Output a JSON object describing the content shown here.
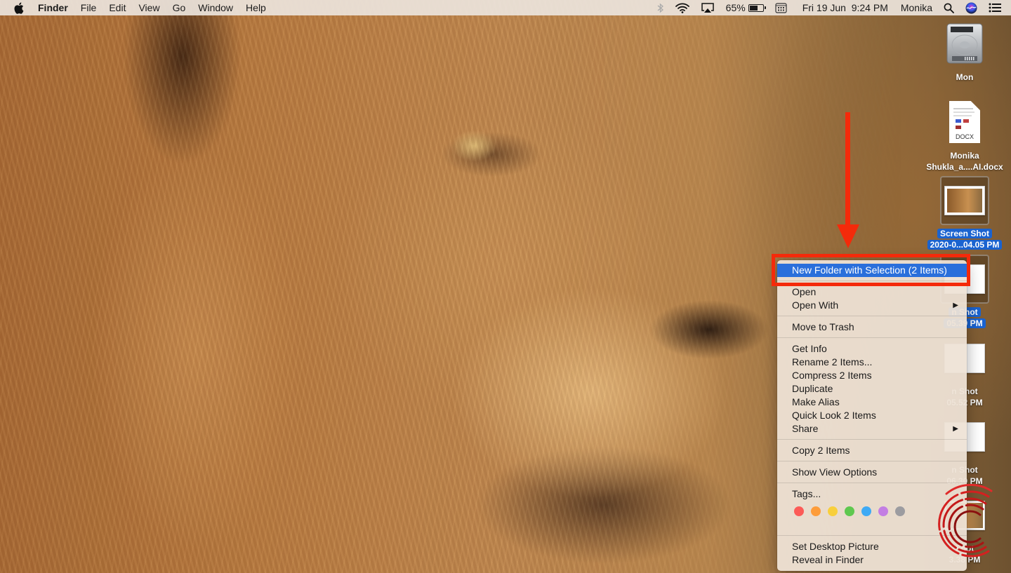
{
  "menubar": {
    "app_name": "Finder",
    "menus": [
      "File",
      "Edit",
      "View",
      "Go",
      "Window",
      "Help"
    ],
    "status": {
      "battery_percent": "65%",
      "battery_level": 0.65,
      "datetime": "Fri 19 Jun  9:24 PM",
      "user": "Monika"
    },
    "icons": [
      "apple-icon",
      "bluetooth-icon",
      "wifi-icon",
      "airplay-icon",
      "battery-icon",
      "keyboard-viewer-icon",
      "spotlight-search-icon",
      "siri-icon",
      "notification-center-icon"
    ]
  },
  "desktop": {
    "icons": [
      {
        "label_line1": "Mon",
        "label_line2": "",
        "type": "hard-drive",
        "selected": false
      },
      {
        "label_line1": "Monika",
        "label_line2": "Shukla_a....AI.docx",
        "type": "docx",
        "badge": "DOCX",
        "selected": false
      },
      {
        "label_line1": "Screen Shot",
        "label_line2": "2020-0...04.05 PM",
        "type": "screenshot",
        "selected": true
      },
      {
        "label_line1": "n Shot",
        "label_line2": "05.39 PM",
        "type": "screenshot",
        "selected": true
      },
      {
        "label_line1": "n Shot",
        "label_line2": "05.52 PM",
        "type": "screenshot",
        "selected": false
      },
      {
        "label_line1": "n Shot",
        "label_line2": "06.30 PM",
        "type": "screenshot",
        "selected": false
      },
      {
        "label_line1": "Shot",
        "label_line2": "3.38 PM",
        "type": "screenshot",
        "selected": false
      }
    ]
  },
  "context_menu": {
    "groups": [
      [
        {
          "label": "New Folder with Selection (2 Items)",
          "highlighted": true
        }
      ],
      [
        {
          "label": "Open"
        },
        {
          "label": "Open With",
          "submenu": true
        }
      ],
      [
        {
          "label": "Move to Trash"
        }
      ],
      [
        {
          "label": "Get Info"
        },
        {
          "label": "Rename 2 Items..."
        },
        {
          "label": "Compress 2 Items"
        },
        {
          "label": "Duplicate"
        },
        {
          "label": "Make Alias"
        },
        {
          "label": "Quick Look 2 Items"
        },
        {
          "label": "Share",
          "submenu": true
        }
      ],
      [
        {
          "label": "Copy 2 Items"
        }
      ],
      [
        {
          "label": "Show View Options"
        }
      ],
      [
        {
          "label": "Tags..."
        }
      ],
      [
        {
          "label": "Set Desktop Picture"
        },
        {
          "label": "Reveal in Finder"
        }
      ]
    ],
    "submenu_arrow": "▶",
    "tag_colors": [
      {
        "name": "Red",
        "color": "#fc5b57"
      },
      {
        "name": "Orange",
        "color": "#fd9c3a"
      },
      {
        "name": "Yellow",
        "color": "#f8cf3c"
      },
      {
        "name": "Green",
        "color": "#5fc84f"
      },
      {
        "name": "Blue",
        "color": "#3eaaf5"
      },
      {
        "name": "Purple",
        "color": "#c37ee3"
      },
      {
        "name": "Gray",
        "color": "#9c9ca0"
      }
    ]
  },
  "annotations": {
    "highlight_color": "#f42a0a",
    "arrow_direction": "down"
  },
  "colors": {
    "selection_blue": "#2a6fdb",
    "label_selection_blue": "#1a63d0"
  }
}
